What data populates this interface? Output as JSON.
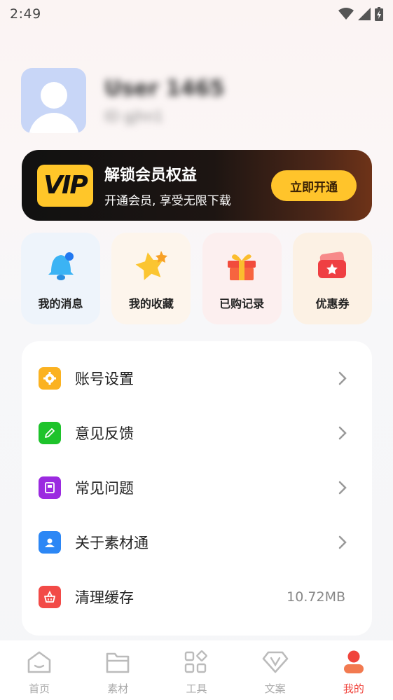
{
  "status_bar": {
    "time": "2:49"
  },
  "profile": {
    "username": "User 1465",
    "user_id": "ID gjhn1"
  },
  "vip": {
    "logo_text": "VIP",
    "title": "解锁会员权益",
    "subtitle": "开通会员, 享受无限下载",
    "button": "立即开通"
  },
  "quick": [
    {
      "label": "我的消息",
      "icon": "bell-icon",
      "bg": "#eef4fb"
    },
    {
      "label": "我的收藏",
      "icon": "star-icon",
      "bg": "#fdf5ec"
    },
    {
      "label": "已购记录",
      "icon": "gift-icon",
      "bg": "#fcefef"
    },
    {
      "label": "优惠券",
      "icon": "coupon-icon",
      "bg": "#fcf1e4"
    }
  ],
  "menu": [
    {
      "label": "账号设置",
      "icon": "settings-icon",
      "color": "#fbb221"
    },
    {
      "label": "意见反馈",
      "icon": "feedback-icon",
      "color": "#1ec32b"
    },
    {
      "label": "常见问题",
      "icon": "faq-icon",
      "color": "#9b2ae0"
    },
    {
      "label": "关于素材通",
      "icon": "about-icon",
      "color": "#2c87f5"
    },
    {
      "label": "清理缓存",
      "icon": "clean-icon",
      "color": "#f24a47",
      "value": "10.72MB"
    }
  ],
  "tabs": [
    {
      "label": "首页",
      "icon": "home-icon"
    },
    {
      "label": "素材",
      "icon": "folder-icon"
    },
    {
      "label": "工具",
      "icon": "tools-icon"
    },
    {
      "label": "文案",
      "icon": "copywriting-icon"
    },
    {
      "label": "我的",
      "icon": "profile-icon",
      "active": true
    }
  ],
  "colors": {
    "accent": "#f0443c",
    "vip_gold": "#ffc42b"
  }
}
